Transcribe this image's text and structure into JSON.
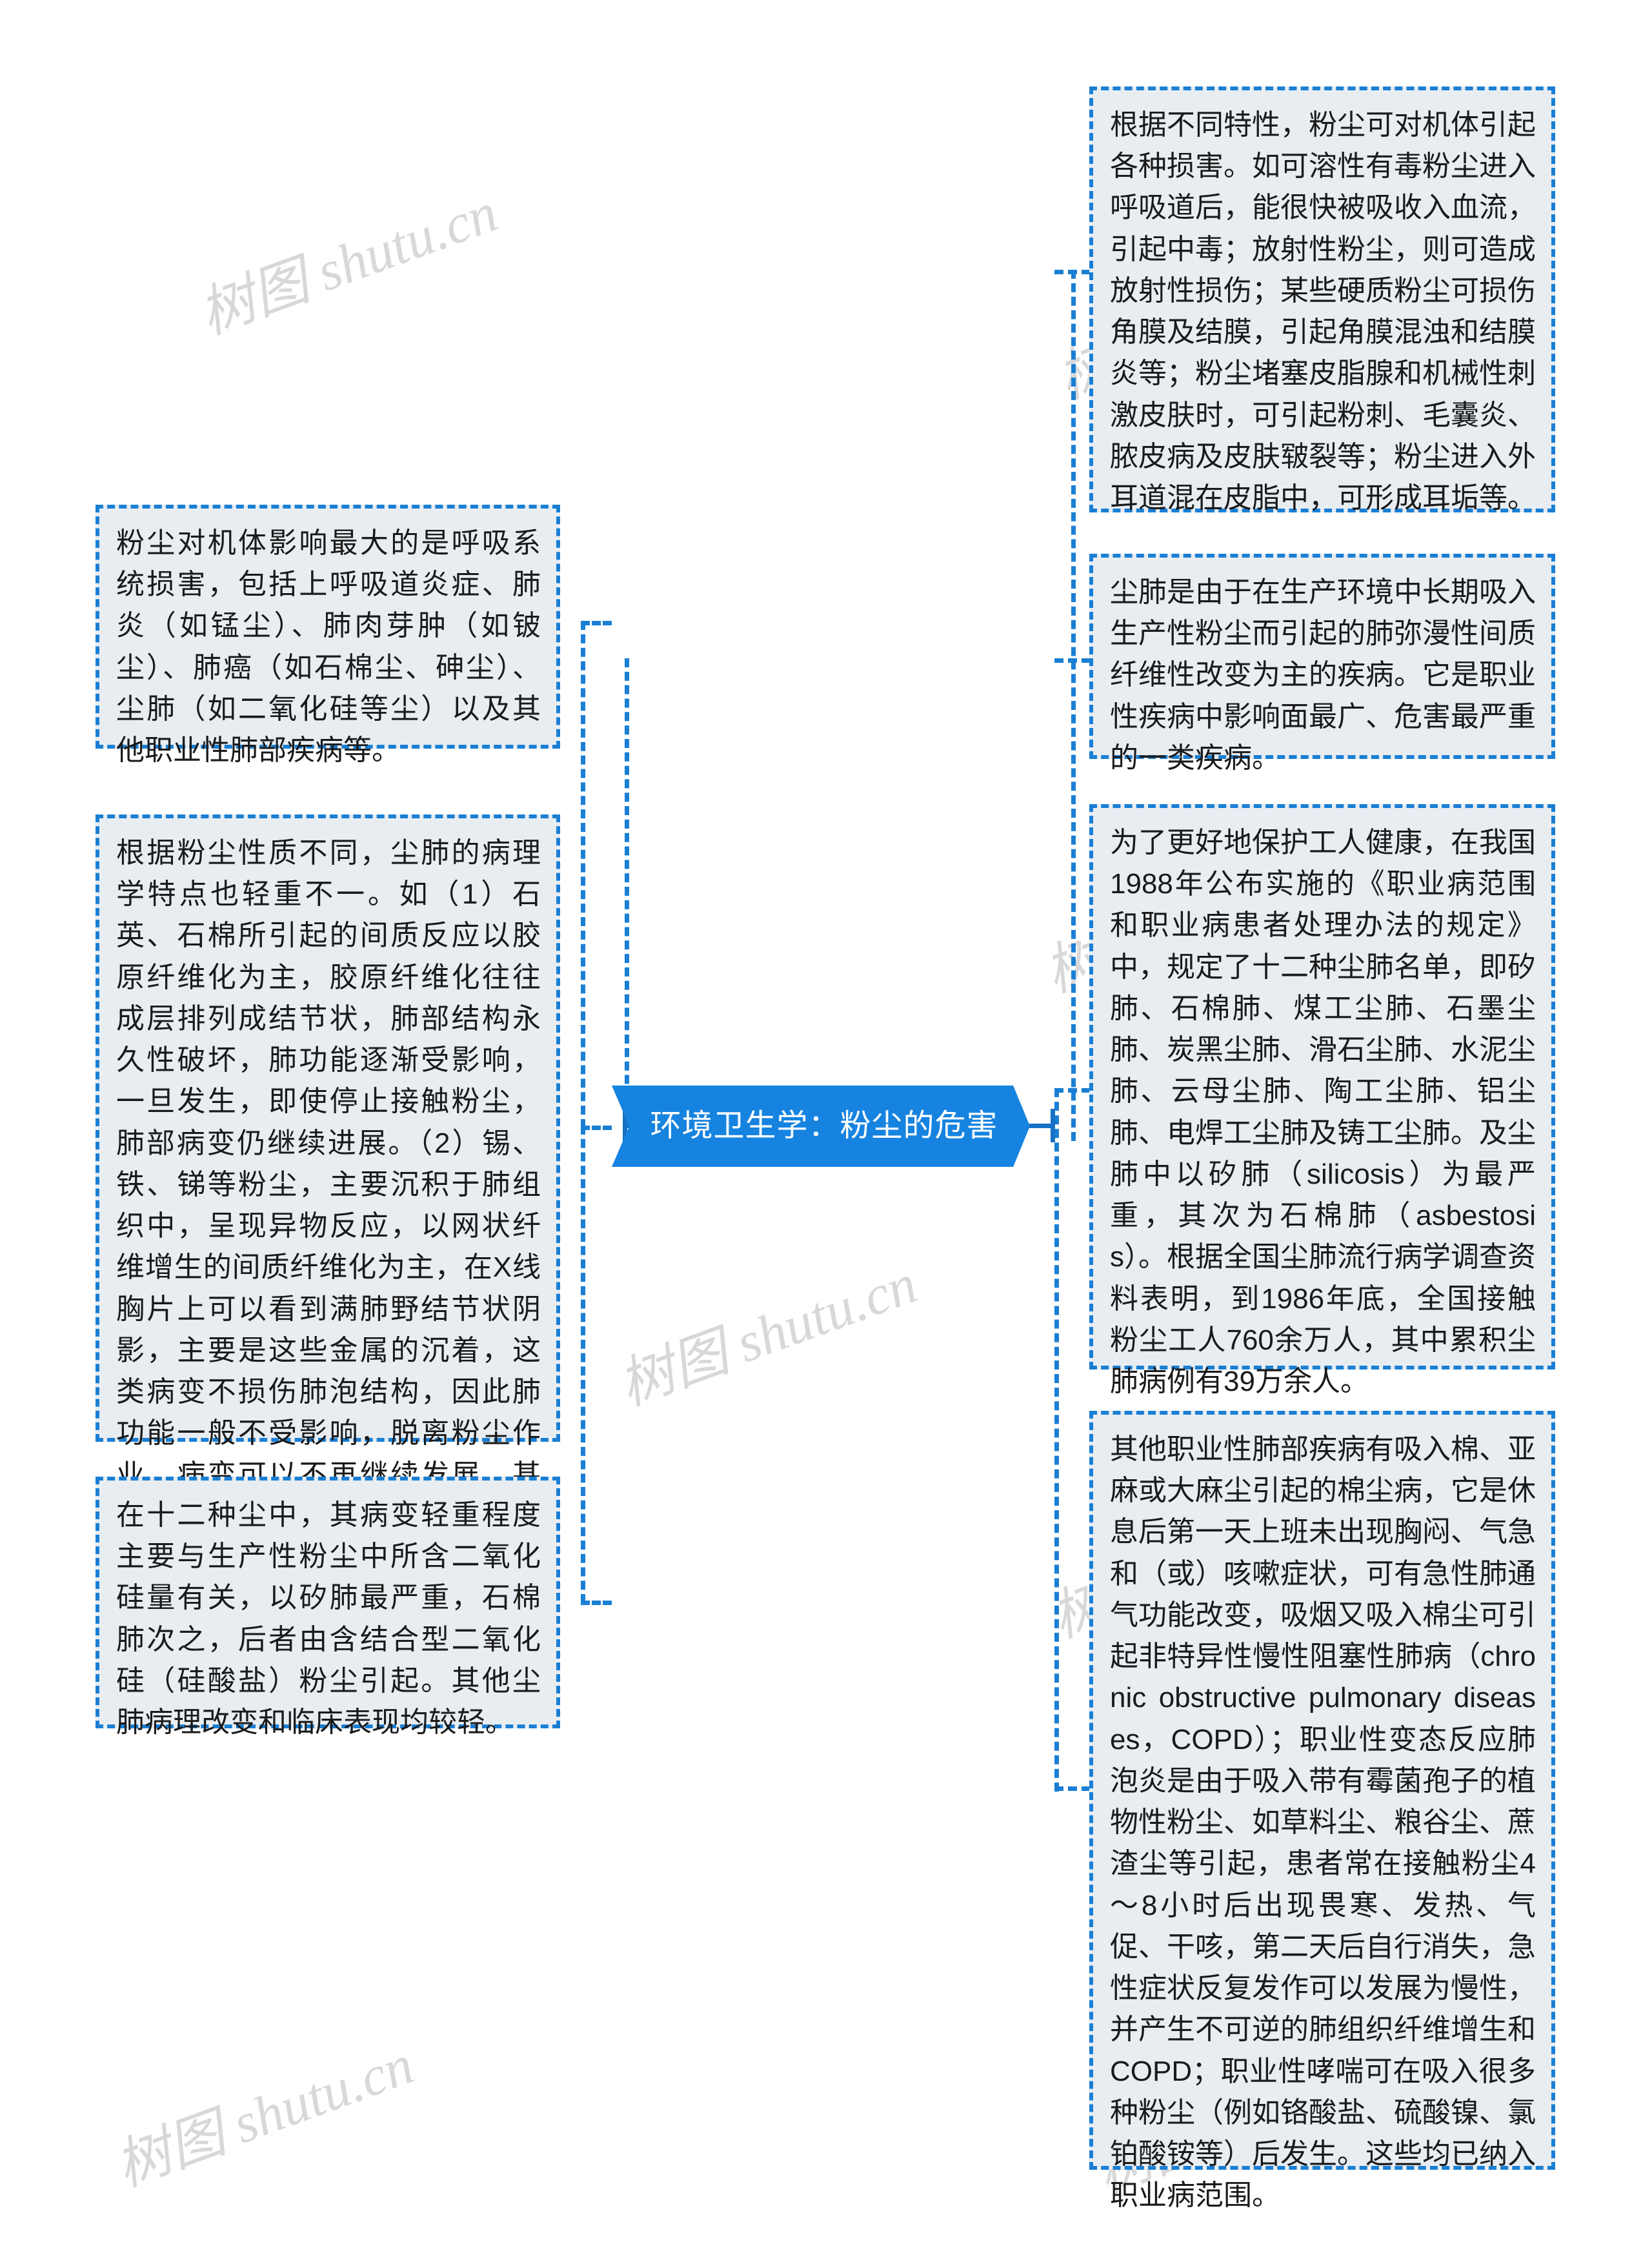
{
  "document": {
    "title": "环境卫生学：粉尘的危害",
    "type": "mind-map",
    "orientation": "horizontal-two-sided"
  },
  "theme": {
    "accent": "#1683e0",
    "connector": "#1a7fd4",
    "node_fill": "#e8edf2",
    "node_border": "#1a7fd4",
    "central_text": "#ffffff",
    "node_text": "#1a1a1a",
    "background": "#ffffff",
    "watermark": "#d8d8d8"
  },
  "central": {
    "label": "环境卫生学：粉尘的危害"
  },
  "branches": {
    "left": [
      {
        "id": "l1",
        "text": "粉尘对机体影响最大的是呼吸系统损害，包括上呼吸道炎症、肺炎（如锰尘）、肺肉芽肿（如铍尘）、肺癌（如石棉尘、砷尘）、尘肺（如二氧化硅等尘）以及其他职业性肺部疾病等。"
      },
      {
        "id": "l2",
        "text": "根据粉尘性质不同，尘肺的病理学特点也轻重不一。如（1）石英、石棉所引起的间质反应以胶原纤维化为主，胶原纤维化往往成层排列成结节状，肺部结构永久性破坏，肺功能逐渐受影响，一旦发生，即使停止接触粉尘，肺部病变仍继续进展。（2）锡、铁、锑等粉尘，主要沉积于肺组织中，呈现异物反应，以网状纤维增生的间质纤维化为主，在X线胸片上可以看到满肺野结节状阴影，主要是这些金属的沉着，这类病变不损伤肺泡结构，因此肺功能一般不受影响，脱离粉尘作业，病变可以不再继续发展，甚至肺部阴影逐渐消退。"
      },
      {
        "id": "l3",
        "text": "在十二种尘中，其病变轻重程度主要与生产性粉尘中所含二氧化硅量有关，以矽肺最严重，石棉肺次之，后者由含结合型二氧化硅（硅酸盐）粉尘引起。其他尘肺病理改变和临床表现均较轻。"
      }
    ],
    "right": [
      {
        "id": "r1",
        "text": "根据不同特性，粉尘可对机体引起各种损害。如可溶性有毒粉尘进入呼吸道后，能很快被吸收入血流，引起中毒；放射性粉尘，则可造成放射性损伤；某些硬质粉尘可损伤角膜及结膜，引起角膜混浊和结膜炎等；粉尘堵塞皮脂腺和机械性刺激皮肤时，可引起粉刺、毛囊炎、脓皮病及皮肤皲裂等；粉尘进入外耳道混在皮脂中，可形成耳垢等。"
      },
      {
        "id": "r2",
        "text": "尘肺是由于在生产环境中长期吸入生产性粉尘而引起的肺弥漫性间质纤维性改变为主的疾病。它是职业性疾病中影响面最广、危害最严重的一类疾病。"
      },
      {
        "id": "r3",
        "text": "为了更好地保护工人健康，在我国1988年公布实施的《职业病范围和职业病患者处理办法的规定》中，规定了十二种尘肺名单，即矽肺、石棉肺、煤工尘肺、石墨尘肺、炭黑尘肺、滑石尘肺、水泥尘肺、云母尘肺、陶工尘肺、铝尘肺、电焊工尘肺及铸工尘肺。及尘肺中以矽肺（silicosis）为最严重，其次为石棉肺（asbestosis）。根据全国尘肺流行病学调查资料表明，到1986年底，全国接触粉尘工人760余万人，其中累积尘肺病例有39万余人。"
      },
      {
        "id": "r4",
        "text": "其他职业性肺部疾病有吸入棉、亚麻或大麻尘引起的棉尘病，它是休息后第一天上班未出现胸闷、气急和（或）咳嗽症状，可有急性肺通气功能改变，吸烟又吸入棉尘可引起非特异性慢性阻塞性肺病（chronic obstructive pulmonary diseases，COPD）；职业性变态反应肺泡炎是由于吸入带有霉菌孢子的植物性粉尘、如草料尘、粮谷尘、蔗渣尘等引起，患者常在接触粉尘4～8小时后出现畏寒、发热、气促、干咳，第二天后自行消失，急性症状反复发作可以发展为慢性，并产生不可逆的肺组织纤维增生和COPD；职业性哮喘可在吸入很多种粉尘（例如铬酸盐、硫酸镍、氯铂酸铵等）后发生。这些均已纳入职业病范围。"
      }
    ]
  },
  "watermarks": [
    {
      "text": "树图 shutu.cn"
    },
    {
      "text": "树图 shutu.cn"
    },
    {
      "text": "树图 shutu.cn"
    },
    {
      "text": "树图 shutu.cn"
    },
    {
      "text": "树图 shutu.cn"
    },
    {
      "text": "树图 shutu.cn"
    },
    {
      "text": "树图 shutu.cn"
    },
    {
      "text": "树图 shutu.cn"
    },
    {
      "text": "树图 shutu.cn"
    }
  ]
}
